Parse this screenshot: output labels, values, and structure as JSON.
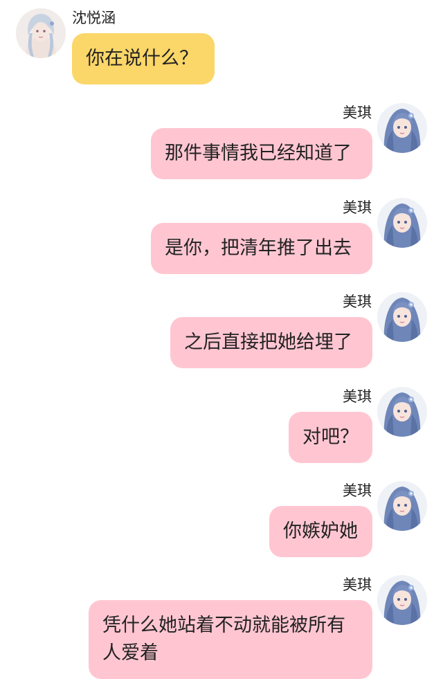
{
  "messages": [
    {
      "side": "left",
      "sender": "沈悦涵",
      "text": "你在说什么？"
    },
    {
      "side": "right",
      "sender": "美琪",
      "text": "那件事情我已经知道了"
    },
    {
      "side": "right",
      "sender": "美琪",
      "text": "是你，把清年推了出去"
    },
    {
      "side": "right",
      "sender": "美琪",
      "text": "之后直接把她给埋了"
    },
    {
      "side": "right",
      "sender": "美琪",
      "text": "对吧？"
    },
    {
      "side": "right",
      "sender": "美琪",
      "text": "你嫉妒她"
    },
    {
      "side": "right",
      "sender": "美琪",
      "text": "凭什么她站着不动就能被所有人爱着"
    }
  ],
  "colors": {
    "left_bubble": "#fbd668",
    "right_bubble": "#ffc6d2",
    "text": "#222222"
  }
}
